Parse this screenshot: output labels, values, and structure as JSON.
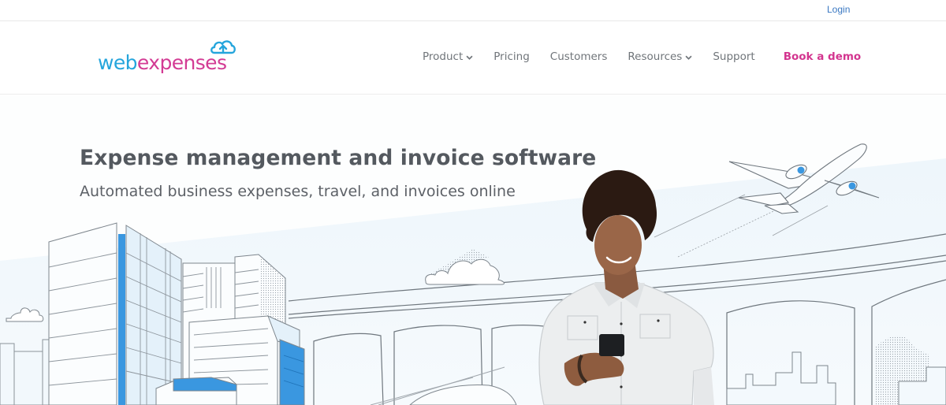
{
  "topbar": {
    "login_label": "Login"
  },
  "brand": {
    "logo_part1": "web",
    "logo_part2": "expenses",
    "colors": {
      "blue": "#25a5dc",
      "pink": "#d33b94"
    },
    "logo_icon": "cloud-upload-icon"
  },
  "nav": {
    "items": [
      {
        "label": "Product",
        "has_dropdown": true,
        "icon": "chevron-down-icon"
      },
      {
        "label": "Pricing",
        "has_dropdown": false
      },
      {
        "label": "Customers",
        "has_dropdown": false
      },
      {
        "label": "Resources",
        "has_dropdown": true,
        "icon": "chevron-down-icon"
      },
      {
        "label": "Support",
        "has_dropdown": false
      }
    ],
    "cta_label": "Book a demo",
    "cta_color": "#d3358f"
  },
  "hero": {
    "title": "Expense management and invoice software",
    "subtitle": "Automated business expenses, travel, and invoices online",
    "illustration": {
      "elements": [
        "city-skyline",
        "airplane",
        "bridge",
        "clouds",
        "train",
        "person-with-phone"
      ],
      "accent_color": "#3a97e0"
    }
  }
}
